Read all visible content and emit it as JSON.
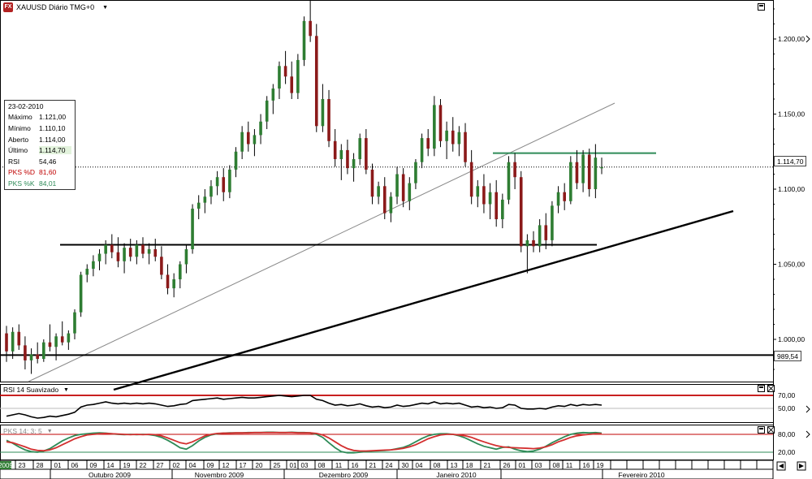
{
  "header": {
    "logo_text": "FX",
    "title": "XAUUSD Diário TMG+0"
  },
  "colors": {
    "candle_up": "#2e7d32",
    "candle_down": "#8b1a1a",
    "wick": "#000000",
    "resistance": "#2e8b57",
    "rsi_level": "#c00000",
    "pks_d": "#d32f2f",
    "pks_k": "#2e8b57"
  },
  "price_axis": {
    "labels": [
      "1.200,00",
      "1.150,00",
      "1.100,00",
      "1.050,00",
      "1.000,00"
    ],
    "current_price": "1.114,70",
    "support_price": "989,54"
  },
  "info_box": {
    "date": "23-02-2010",
    "rows": [
      {
        "label": "Máximo",
        "value": "1.121,00"
      },
      {
        "label": "Mínimo",
        "value": "1.110,10"
      },
      {
        "label": "Aberto",
        "value": "1.114,00"
      },
      {
        "label": "Último",
        "value": "1.114,70"
      },
      {
        "label": "RSI",
        "value": "54,46"
      },
      {
        "label": "PKS %D",
        "value": "81,60"
      },
      {
        "label": "PKS %K",
        "value": "84,01"
      }
    ]
  },
  "rsi_pane": {
    "label": "RSI 14 Suavizado",
    "axis_labels": [
      "70,00",
      "50,00"
    ]
  },
  "pks_pane": {
    "label": "PKS 14; 3; 5",
    "axis_labels": [
      "80,00",
      "20,00"
    ]
  },
  "date_axis": {
    "days": [
      "2009",
      "23",
      "28",
      "01",
      "06",
      "09",
      "14",
      "19",
      "22",
      "27",
      "02",
      "04",
      "09",
      "12",
      "17",
      "20",
      "25",
      "01",
      "03",
      "08",
      "11",
      "16",
      "21",
      "24",
      "30",
      "04",
      "08",
      "13",
      "18",
      "21",
      "26",
      "01",
      "03",
      "08",
      "11",
      "16",
      "19"
    ],
    "months": [
      "Outubro 2009",
      "Novembro 2009",
      "Dezembro 2009",
      "Janeiro 2010",
      "Fevereiro 2010"
    ]
  },
  "chart_data": {
    "type": "candlestick",
    "title": "XAUUSD Diário TMG+0",
    "ylim": [
      975,
      1225
    ],
    "candles": [
      {
        "o": 1004,
        "h": 1009,
        "l": 985,
        "c": 992
      },
      {
        "o": 992,
        "h": 1008,
        "l": 987,
        "c": 1005
      },
      {
        "o": 1005,
        "h": 1010,
        "l": 993,
        "c": 996
      },
      {
        "o": 996,
        "h": 1002,
        "l": 980,
        "c": 986
      },
      {
        "o": 986,
        "h": 994,
        "l": 977,
        "c": 990
      },
      {
        "o": 990,
        "h": 998,
        "l": 984,
        "c": 987
      },
      {
        "o": 987,
        "h": 1000,
        "l": 985,
        "c": 998
      },
      {
        "o": 998,
        "h": 1010,
        "l": 992,
        "c": 995
      },
      {
        "o": 995,
        "h": 1004,
        "l": 986,
        "c": 1002
      },
      {
        "o": 1002,
        "h": 1012,
        "l": 996,
        "c": 998
      },
      {
        "o": 998,
        "h": 1006,
        "l": 993,
        "c": 1004
      },
      {
        "o": 1004,
        "h": 1020,
        "l": 1000,
        "c": 1018
      },
      {
        "o": 1018,
        "h": 1045,
        "l": 1015,
        "c": 1043
      },
      {
        "o": 1043,
        "h": 1050,
        "l": 1038,
        "c": 1047
      },
      {
        "o": 1047,
        "h": 1056,
        "l": 1042,
        "c": 1052
      },
      {
        "o": 1052,
        "h": 1060,
        "l": 1046,
        "c": 1057
      },
      {
        "o": 1057,
        "h": 1066,
        "l": 1050,
        "c": 1063
      },
      {
        "o": 1063,
        "h": 1070,
        "l": 1054,
        "c": 1058
      },
      {
        "o": 1058,
        "h": 1068,
        "l": 1048,
        "c": 1052
      },
      {
        "o": 1052,
        "h": 1064,
        "l": 1044,
        "c": 1061
      },
      {
        "o": 1061,
        "h": 1067,
        "l": 1052,
        "c": 1055
      },
      {
        "o": 1055,
        "h": 1066,
        "l": 1050,
        "c": 1063
      },
      {
        "o": 1063,
        "h": 1068,
        "l": 1054,
        "c": 1057
      },
      {
        "o": 1057,
        "h": 1064,
        "l": 1050,
        "c": 1060
      },
      {
        "o": 1060,
        "h": 1067,
        "l": 1052,
        "c": 1055
      },
      {
        "o": 1055,
        "h": 1062,
        "l": 1040,
        "c": 1043
      },
      {
        "o": 1043,
        "h": 1050,
        "l": 1030,
        "c": 1034
      },
      {
        "o": 1034,
        "h": 1044,
        "l": 1028,
        "c": 1040
      },
      {
        "o": 1040,
        "h": 1052,
        "l": 1034,
        "c": 1050
      },
      {
        "o": 1050,
        "h": 1063,
        "l": 1044,
        "c": 1060
      },
      {
        "o": 1060,
        "h": 1090,
        "l": 1057,
        "c": 1087
      },
      {
        "o": 1087,
        "h": 1096,
        "l": 1080,
        "c": 1091
      },
      {
        "o": 1091,
        "h": 1100,
        "l": 1084,
        "c": 1095
      },
      {
        "o": 1095,
        "h": 1106,
        "l": 1090,
        "c": 1102
      },
      {
        "o": 1102,
        "h": 1112,
        "l": 1096,
        "c": 1108
      },
      {
        "o": 1108,
        "h": 1114,
        "l": 1092,
        "c": 1098
      },
      {
        "o": 1098,
        "h": 1116,
        "l": 1094,
        "c": 1113
      },
      {
        "o": 1113,
        "h": 1128,
        "l": 1108,
        "c": 1125
      },
      {
        "o": 1125,
        "h": 1142,
        "l": 1120,
        "c": 1138
      },
      {
        "o": 1138,
        "h": 1145,
        "l": 1125,
        "c": 1130
      },
      {
        "o": 1130,
        "h": 1140,
        "l": 1122,
        "c": 1136
      },
      {
        "o": 1136,
        "h": 1150,
        "l": 1130,
        "c": 1145
      },
      {
        "o": 1145,
        "h": 1162,
        "l": 1140,
        "c": 1159
      },
      {
        "o": 1159,
        "h": 1170,
        "l": 1150,
        "c": 1167
      },
      {
        "o": 1167,
        "h": 1185,
        "l": 1160,
        "c": 1182
      },
      {
        "o": 1182,
        "h": 1192,
        "l": 1170,
        "c": 1175
      },
      {
        "o": 1175,
        "h": 1185,
        "l": 1160,
        "c": 1164
      },
      {
        "o": 1164,
        "h": 1190,
        "l": 1160,
        "c": 1186
      },
      {
        "o": 1186,
        "h": 1215,
        "l": 1182,
        "c": 1212
      },
      {
        "o": 1212,
        "h": 1226,
        "l": 1198,
        "c": 1202
      },
      {
        "o": 1202,
        "h": 1210,
        "l": 1138,
        "c": 1142
      },
      {
        "o": 1142,
        "h": 1170,
        "l": 1138,
        "c": 1160
      },
      {
        "o": 1160,
        "h": 1166,
        "l": 1128,
        "c": 1132
      },
      {
        "o": 1132,
        "h": 1140,
        "l": 1115,
        "c": 1120
      },
      {
        "o": 1120,
        "h": 1130,
        "l": 1106,
        "c": 1126
      },
      {
        "o": 1126,
        "h": 1133,
        "l": 1110,
        "c": 1114
      },
      {
        "o": 1114,
        "h": 1124,
        "l": 1105,
        "c": 1120
      },
      {
        "o": 1120,
        "h": 1137,
        "l": 1116,
        "c": 1134
      },
      {
        "o": 1134,
        "h": 1140,
        "l": 1110,
        "c": 1113
      },
      {
        "o": 1113,
        "h": 1117,
        "l": 1090,
        "c": 1095
      },
      {
        "o": 1095,
        "h": 1105,
        "l": 1090,
        "c": 1102
      },
      {
        "o": 1102,
        "h": 1108,
        "l": 1080,
        "c": 1084
      },
      {
        "o": 1084,
        "h": 1098,
        "l": 1078,
        "c": 1095
      },
      {
        "o": 1095,
        "h": 1115,
        "l": 1090,
        "c": 1110
      },
      {
        "o": 1110,
        "h": 1114,
        "l": 1088,
        "c": 1092
      },
      {
        "o": 1092,
        "h": 1108,
        "l": 1086,
        "c": 1104
      },
      {
        "o": 1104,
        "h": 1120,
        "l": 1100,
        "c": 1118
      },
      {
        "o": 1118,
        "h": 1137,
        "l": 1114,
        "c": 1134
      },
      {
        "o": 1134,
        "h": 1140,
        "l": 1122,
        "c": 1127
      },
      {
        "o": 1127,
        "h": 1162,
        "l": 1122,
        "c": 1156
      },
      {
        "o": 1156,
        "h": 1160,
        "l": 1128,
        "c": 1132
      },
      {
        "o": 1132,
        "h": 1145,
        "l": 1120,
        "c": 1139
      },
      {
        "o": 1139,
        "h": 1148,
        "l": 1125,
        "c": 1130
      },
      {
        "o": 1130,
        "h": 1142,
        "l": 1122,
        "c": 1138
      },
      {
        "o": 1138,
        "h": 1144,
        "l": 1115,
        "c": 1118
      },
      {
        "o": 1118,
        "h": 1126,
        "l": 1090,
        "c": 1095
      },
      {
        "o": 1095,
        "h": 1106,
        "l": 1088,
        "c": 1102
      },
      {
        "o": 1102,
        "h": 1110,
        "l": 1084,
        "c": 1090
      },
      {
        "o": 1090,
        "h": 1104,
        "l": 1080,
        "c": 1098
      },
      {
        "o": 1098,
        "h": 1106,
        "l": 1075,
        "c": 1080
      },
      {
        "o": 1080,
        "h": 1097,
        "l": 1074,
        "c": 1093
      },
      {
        "o": 1093,
        "h": 1122,
        "l": 1090,
        "c": 1118
      },
      {
        "o": 1118,
        "h": 1124,
        "l": 1100,
        "c": 1108
      },
      {
        "o": 1108,
        "h": 1112,
        "l": 1058,
        "c": 1062
      },
      {
        "o": 1062,
        "h": 1070,
        "l": 1044,
        "c": 1066
      },
      {
        "o": 1066,
        "h": 1072,
        "l": 1058,
        "c": 1062
      },
      {
        "o": 1062,
        "h": 1080,
        "l": 1058,
        "c": 1076
      },
      {
        "o": 1076,
        "h": 1084,
        "l": 1060,
        "c": 1066
      },
      {
        "o": 1066,
        "h": 1092,
        "l": 1062,
        "c": 1089
      },
      {
        "o": 1089,
        "h": 1102,
        "l": 1084,
        "c": 1098
      },
      {
        "o": 1098,
        "h": 1104,
        "l": 1086,
        "c": 1092
      },
      {
        "o": 1092,
        "h": 1122,
        "l": 1090,
        "c": 1118
      },
      {
        "o": 1118,
        "h": 1126,
        "l": 1100,
        "c": 1104
      },
      {
        "o": 1104,
        "h": 1126,
        "l": 1098,
        "c": 1123
      },
      {
        "o": 1123,
        "h": 1127,
        "l": 1095,
        "c": 1100
      },
      {
        "o": 1100,
        "h": 1130,
        "l": 1094,
        "c": 1121
      },
      {
        "o": 1114,
        "h": 1121,
        "l": 1110,
        "c": 1114.7
      }
    ],
    "horizontal_lines": [
      {
        "value": 1063,
        "label": "support"
      },
      {
        "value": 1124,
        "label": "resistance"
      },
      {
        "value": 989.54,
        "label": "989,54"
      }
    ],
    "rsi": [
      38,
      40,
      42,
      40,
      37,
      35,
      36,
      38,
      37,
      39,
      41,
      44,
      52,
      55,
      56,
      58,
      60,
      58,
      57,
      58,
      57,
      58,
      57,
      58,
      57,
      55,
      53,
      54,
      56,
      57,
      62,
      63,
      64,
      65,
      66,
      64,
      65,
      66,
      67,
      66,
      66,
      67,
      68,
      69,
      70,
      69,
      68,
      69,
      70,
      70,
      64,
      62,
      58,
      55,
      56,
      54,
      55,
      57,
      54,
      52,
      53,
      51,
      52,
      55,
      53,
      54,
      56,
      58,
      57,
      60,
      57,
      58,
      57,
      58,
      55,
      52,
      53,
      51,
      52,
      50,
      51,
      56,
      55,
      50,
      49,
      49,
      50,
      49,
      52,
      54,
      53,
      56,
      54,
      56,
      55,
      56,
      55
    ],
    "pks_d": [
      55,
      52,
      45,
      38,
      30,
      26,
      25,
      28,
      35,
      45,
      55,
      65,
      72,
      78,
      80,
      82,
      83,
      82,
      81,
      80,
      79,
      80,
      79,
      80,
      79,
      75,
      68,
      60,
      52,
      48,
      55,
      65,
      75,
      80,
      83,
      84,
      84,
      85,
      85,
      85,
      86,
      86,
      86,
      86,
      86,
      86,
      86,
      85,
      85,
      85,
      83,
      78,
      68,
      55,
      42,
      32,
      26,
      24,
      24,
      25,
      26,
      27,
      28,
      30,
      33,
      38,
      45,
      55,
      65,
      72,
      78,
      80,
      80,
      78,
      75,
      70,
      62,
      55,
      48,
      42,
      38,
      36,
      35,
      34,
      33,
      32,
      34,
      38,
      45,
      55,
      62,
      70,
      75,
      78,
      80,
      82,
      82
    ],
    "pks_k": [
      60,
      50,
      38,
      28,
      22,
      20,
      24,
      32,
      45,
      58,
      68,
      76,
      80,
      82,
      84,
      85,
      84,
      82,
      80,
      79,
      80,
      79,
      80,
      79,
      76,
      70,
      60,
      48,
      35,
      30,
      42,
      58,
      70,
      78,
      82,
      84,
      85,
      85,
      85,
      86,
      86,
      86,
      87,
      87,
      86,
      86,
      87,
      86,
      86,
      85,
      80,
      70,
      52,
      35,
      22,
      18,
      18,
      20,
      22,
      24,
      25,
      26,
      28,
      32,
      36,
      44,
      55,
      66,
      75,
      80,
      82,
      82,
      80,
      75,
      68,
      58,
      48,
      40,
      35,
      30,
      36,
      38,
      30,
      25,
      22,
      24,
      30,
      40,
      52,
      62,
      72,
      80,
      84,
      86,
      85,
      86,
      84
    ]
  }
}
